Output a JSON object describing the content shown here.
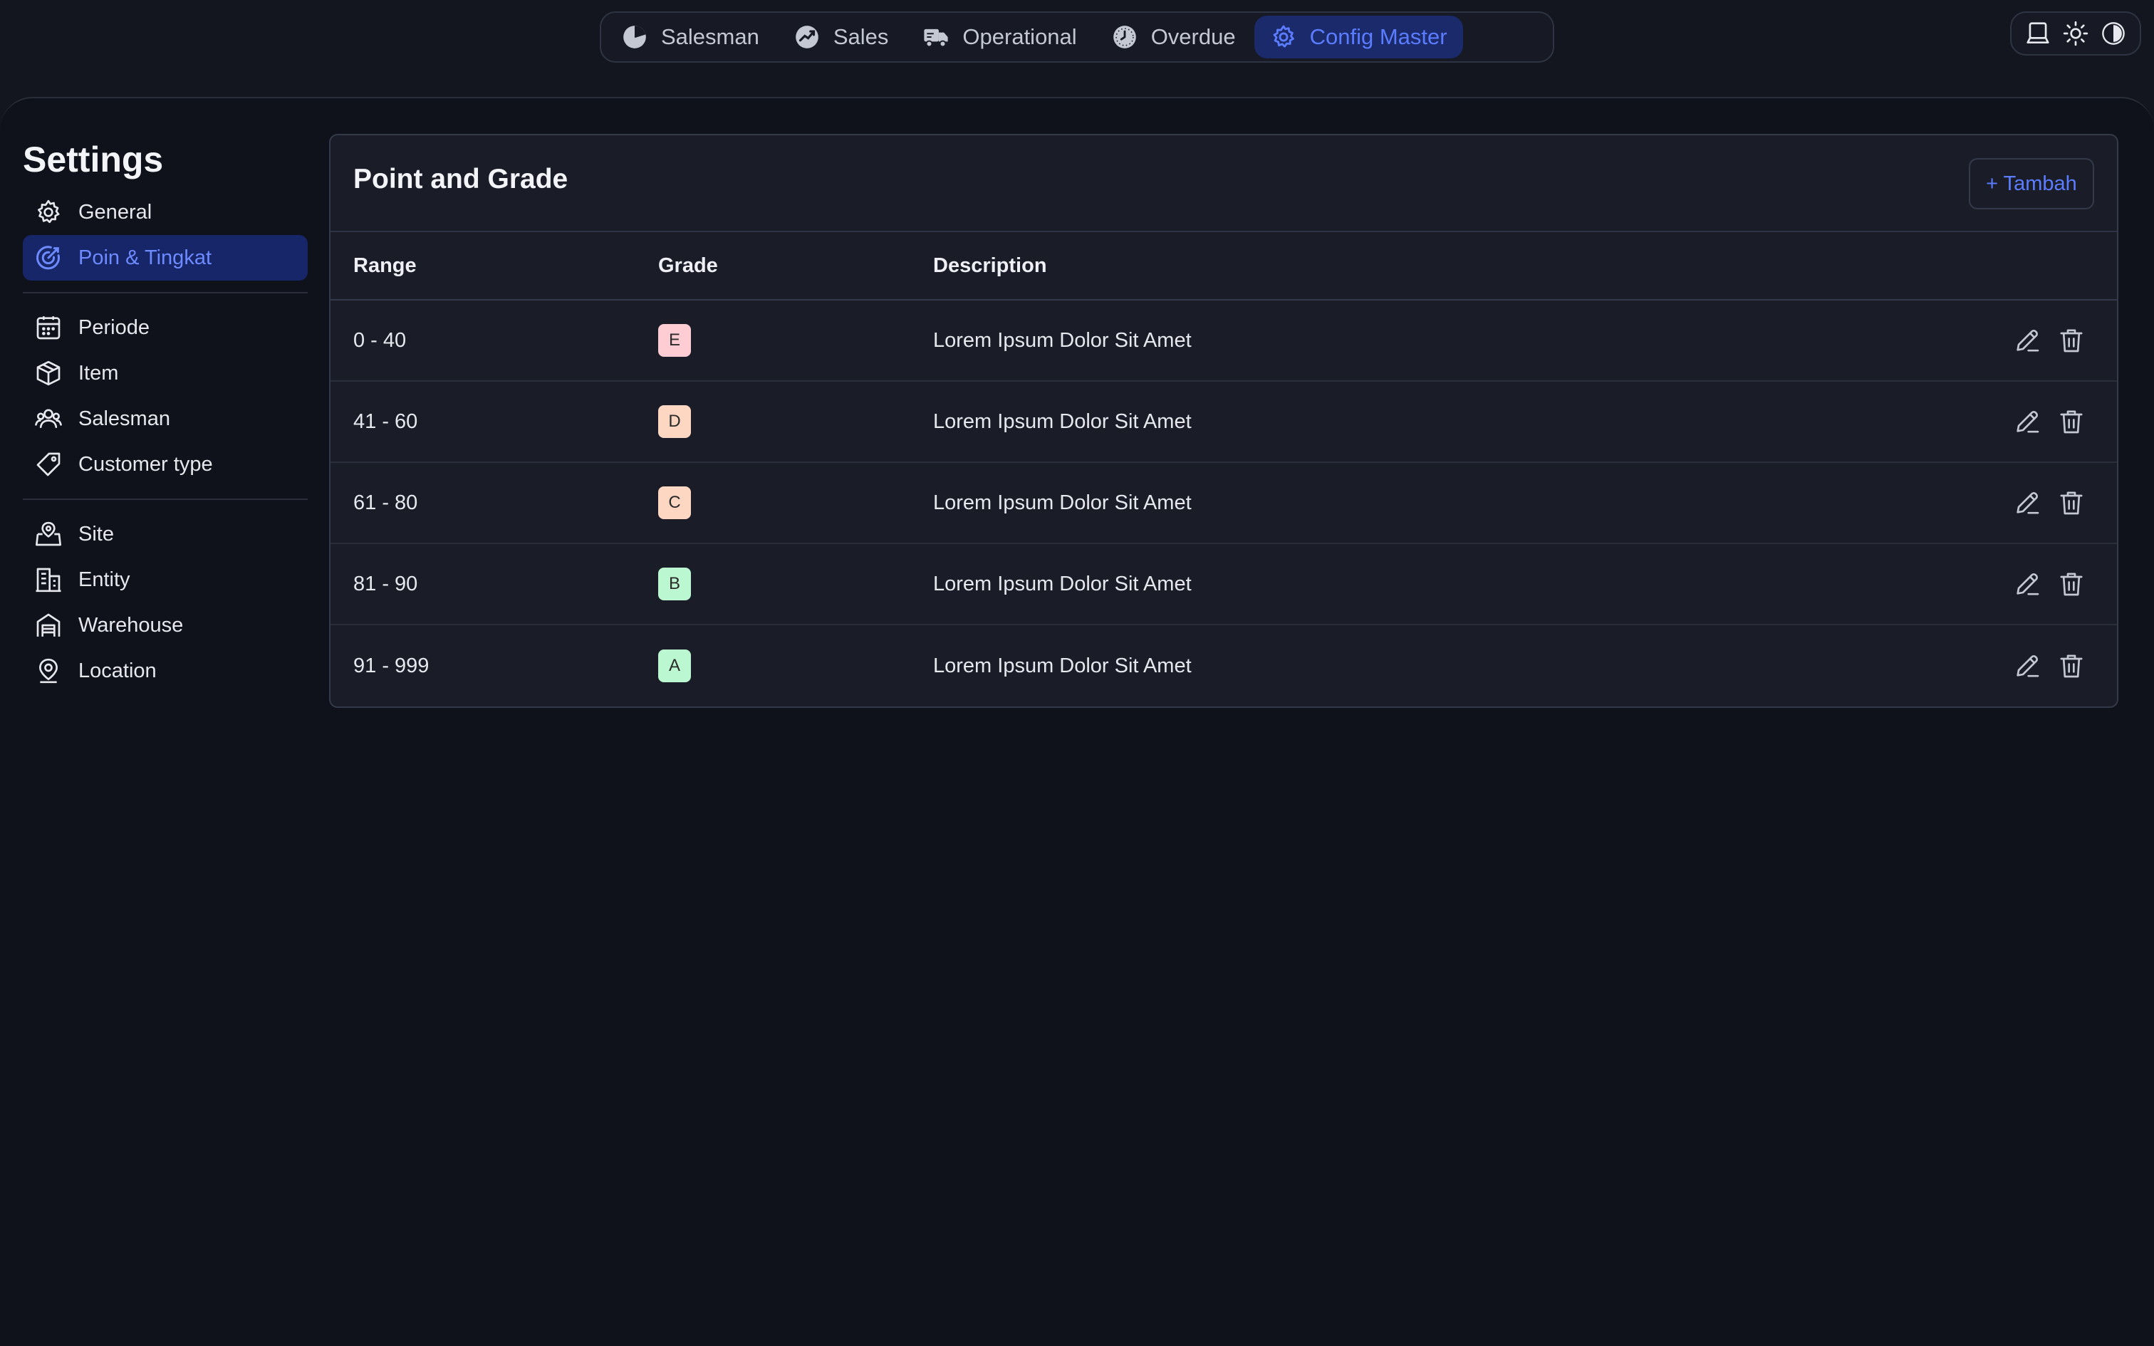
{
  "nav": {
    "tabs": [
      {
        "label": "Salesman",
        "icon": "pie-chart-icon"
      },
      {
        "label": "Sales",
        "icon": "trend-chart-icon"
      },
      {
        "label": "Operational",
        "icon": "truck-icon"
      },
      {
        "label": "Overdue",
        "icon": "clock-icon"
      },
      {
        "label": "Config Master",
        "icon": "gear-icon",
        "active": true
      }
    ]
  },
  "theme_switch": {
    "options": [
      "laptop-icon",
      "sun-icon",
      "contrast-icon"
    ]
  },
  "sidebar": {
    "title": "Settings",
    "groups": [
      [
        {
          "label": "General",
          "icon": "gear-icon"
        },
        {
          "label": "Poin & Tingkat",
          "icon": "target-icon",
          "active": true
        }
      ],
      [
        {
          "label": "Periode",
          "icon": "calendar-icon"
        },
        {
          "label": "Item",
          "icon": "box-icon"
        },
        {
          "label": "Salesman",
          "icon": "users-icon"
        },
        {
          "label": "Customer type",
          "icon": "tag-icon"
        }
      ],
      [
        {
          "label": "Site",
          "icon": "site-icon"
        },
        {
          "label": "Entity",
          "icon": "building-icon"
        },
        {
          "label": "Warehouse",
          "icon": "warehouse-icon"
        },
        {
          "label": "Location",
          "icon": "location-pin-icon"
        }
      ]
    ]
  },
  "card": {
    "title": "Point and Grade",
    "add_label": "+ Tambah",
    "columns": [
      "Range",
      "Grade",
      "Description"
    ],
    "rows": [
      {
        "range": "0 - 40",
        "grade": "E",
        "description": "Lorem Ipsum Dolor Sit Amet"
      },
      {
        "range": "41 - 60",
        "grade": "D",
        "description": "Lorem Ipsum Dolor Sit Amet"
      },
      {
        "range": "61 - 80",
        "grade": "C",
        "description": "Lorem Ipsum Dolor Sit Amet"
      },
      {
        "range": "81 - 90",
        "grade": "B",
        "description": "Lorem Ipsum Dolor Sit Amet"
      },
      {
        "range": "91 - 999",
        "grade": "A",
        "description": "Lorem Ipsum Dolor Sit Amet"
      }
    ]
  },
  "colors": {
    "accent": "#5b7cff",
    "grade_E": "#fecdd3",
    "grade_D": "#fed7c3",
    "grade_C": "#fed7c3",
    "grade_B": "#bbf7d0",
    "grade_A": "#bbf7d0"
  }
}
